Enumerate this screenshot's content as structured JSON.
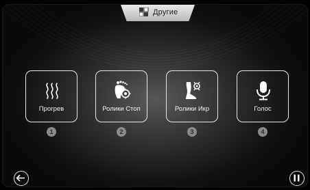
{
  "header": {
    "title": "Другие",
    "icon": "grid-icon"
  },
  "tiles": [
    {
      "label": "Прогрев",
      "icon": "heat-waves-icon",
      "number": "1"
    },
    {
      "label": "Ролики Стоп",
      "icon": "foot-rollers-icon",
      "number": "2"
    },
    {
      "label": "Ролики Икр",
      "icon": "calf-rollers-icon",
      "number": "3"
    },
    {
      "label": "Голос",
      "icon": "microphone-icon",
      "number": "4"
    }
  ],
  "controls": {
    "back_icon": "back-arrow-icon",
    "pause_icon": "pause-icon"
  }
}
